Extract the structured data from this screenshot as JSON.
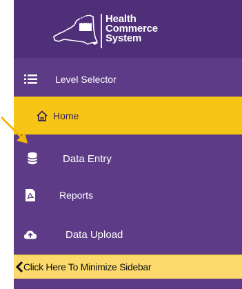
{
  "logo": {
    "state_name": "NEW YORK STATE",
    "title_line1": "Health",
    "title_line2": "Commerce",
    "title_line3": "System"
  },
  "menu": {
    "items": [
      {
        "label": "Level Selector",
        "icon": "list-icon",
        "active": false
      },
      {
        "label": "Home",
        "icon": "home-icon",
        "active": true
      },
      {
        "label": "Data Entry",
        "icon": "database-icon",
        "active": false
      },
      {
        "label": "Reports",
        "icon": "pdf-document-icon",
        "active": false
      },
      {
        "label": "Data Upload",
        "icon": "cloud-upload-icon",
        "active": false
      }
    ]
  },
  "minimize": {
    "label": "Click Here To Minimize Sidebar",
    "icon": "chevron-left-icon"
  },
  "annotation": {
    "icon": "pointer-arrow-icon",
    "color": "#f2b705"
  },
  "colors": {
    "sidebar": "#5e3b87",
    "header": "#4f2f78",
    "active_item": "#f6c515",
    "minimize_bar": "#fbd96b"
  }
}
